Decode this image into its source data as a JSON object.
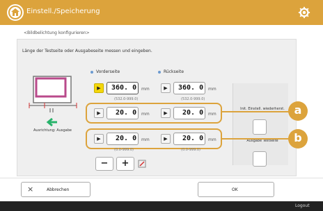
{
  "header": {
    "title": "Einstell./Speicherung",
    "home_icon": "home-icon",
    "settings_icon": "gear-icon",
    "accent": "#dca33c"
  },
  "subtitle": "<Bildbelichtung konfigurieren>",
  "instruction": "Länge der Testseite oder Ausgabeseite messen und eingeben.",
  "columns": {
    "front": "Vorderseite",
    "back": "Rückseite"
  },
  "rows": {
    "length": {
      "front": "360. 0",
      "back": "360. 0",
      "unit": "mm",
      "front_range": "(532.0-999.0)",
      "back_range": "(532.0-999.0)"
    },
    "row_a": {
      "front": "20. 0",
      "back": "20. 0",
      "unit": "mm"
    },
    "row_b": {
      "front": "20. 0",
      "back": "20. 0",
      "unit": "mm"
    },
    "row_b_ranges": {
      "front": "(0.0-999.0)",
      "back": "(0.0-999.0)"
    }
  },
  "side_label": "Ausrichtung: Ausgabe",
  "stepper": {
    "minus": "−",
    "plus": "+"
  },
  "right_buttons": {
    "reset": "Init. Einstell. wiederherst.",
    "output": "Ausgabe Testseite"
  },
  "callouts": {
    "a": "a",
    "b": "b"
  },
  "footer": {
    "cancel": "Abbrechen",
    "ok": "OK",
    "cancel_icon": "×",
    "logout": "Logout"
  }
}
